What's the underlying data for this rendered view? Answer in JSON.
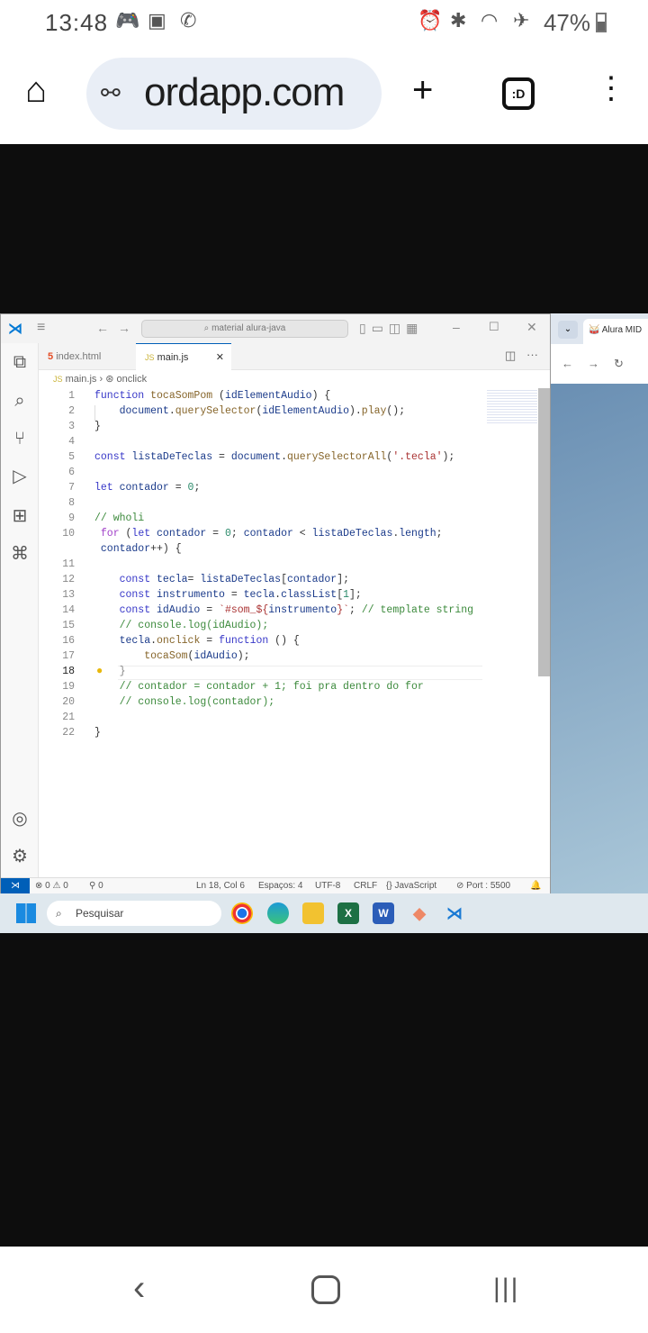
{
  "phone_status": {
    "time": "13:48",
    "battery": "47%",
    "left_icons": [
      "discord-icon",
      "voicemail-icon",
      "whatsapp-icon"
    ],
    "right_icons": [
      "alarm-icon",
      "bluetooth-icon",
      "wifi-icon",
      "airplane-icon"
    ]
  },
  "browser_toolbar": {
    "url": "ordapp.com",
    "tabs_label": ":D"
  },
  "vscode": {
    "search": "material alura-java",
    "tabs": [
      {
        "label": "index.html",
        "icon": "5"
      },
      {
        "label": "main.js",
        "icon": "JS"
      }
    ],
    "breadcrumb": {
      "file": "main.js",
      "symbol": "onclick",
      "icon": "JS"
    },
    "current_line": 18,
    "lines": [
      {
        "n": "1",
        "tokens": [
          [
            "kw",
            "function "
          ],
          [
            "fn",
            "tocaSomPom"
          ],
          [
            "pn",
            " ("
          ],
          [
            "vr",
            "idElementAudio"
          ],
          [
            "pn",
            ") {"
          ]
        ]
      },
      {
        "n": "2",
        "tokens": [
          [
            "vr",
            "    document"
          ],
          [
            "pn",
            "."
          ],
          [
            "fn",
            "querySelector"
          ],
          [
            "pn",
            "("
          ],
          [
            "vr",
            "idElementAudio"
          ],
          [
            "pn",
            ")."
          ],
          [
            "fn",
            "play"
          ],
          [
            "pn",
            "();"
          ]
        ]
      },
      {
        "n": "3",
        "tokens": [
          [
            "pn",
            "}"
          ]
        ]
      },
      {
        "n": "4",
        "tokens": []
      },
      {
        "n": "5",
        "tokens": [
          [
            "kw",
            "const "
          ],
          [
            "vr",
            "listaDeTeclas"
          ],
          [
            "pn",
            " = "
          ],
          [
            "vr",
            "document"
          ],
          [
            "pn",
            "."
          ],
          [
            "fn",
            "querySelectorAll"
          ],
          [
            "pn",
            "("
          ],
          [
            "str",
            "'.tecla'"
          ],
          [
            "pn",
            ");"
          ]
        ]
      },
      {
        "n": "6",
        "tokens": []
      },
      {
        "n": "7",
        "tokens": [
          [
            "kw",
            "let "
          ],
          [
            "vr",
            "contador"
          ],
          [
            "pn",
            " = "
          ],
          [
            "num",
            "0"
          ],
          [
            "pn",
            ";"
          ]
        ]
      },
      {
        "n": "8",
        "tokens": []
      },
      {
        "n": "9",
        "tokens": [
          [
            "cm",
            "// wholi"
          ]
        ]
      },
      {
        "n": "10",
        "tokens": [
          [
            "ctl",
            " for"
          ],
          [
            "pn",
            " ("
          ],
          [
            "kw",
            "let "
          ],
          [
            "vr",
            "contador"
          ],
          [
            "pn",
            " = "
          ],
          [
            "num",
            "0"
          ],
          [
            "pn",
            "; "
          ],
          [
            "vr",
            "contador"
          ],
          [
            "pn",
            " < "
          ],
          [
            "vr",
            "listaDeTeclas"
          ],
          [
            "pn",
            "."
          ],
          [
            "vr",
            "length"
          ],
          [
            "pn",
            ";"
          ]
        ]
      },
      {
        "n": "",
        "tokens": [
          [
            "vr",
            " contador"
          ],
          [
            "pn",
            "++) {"
          ]
        ]
      },
      {
        "n": "11",
        "tokens": []
      },
      {
        "n": "12",
        "tokens": [
          [
            "kw",
            "    const "
          ],
          [
            "vr",
            "tecla"
          ],
          [
            "pn",
            "= "
          ],
          [
            "vr",
            "listaDeTeclas"
          ],
          [
            "pn",
            "["
          ],
          [
            "vr",
            "contador"
          ],
          [
            "pn",
            "];"
          ]
        ]
      },
      {
        "n": "13",
        "tokens": [
          [
            "kw",
            "    const "
          ],
          [
            "vr",
            "instrumento"
          ],
          [
            "pn",
            " = "
          ],
          [
            "vr",
            "tecla"
          ],
          [
            "pn",
            "."
          ],
          [
            "vr",
            "classList"
          ],
          [
            "pn",
            "["
          ],
          [
            "num",
            "1"
          ],
          [
            "pn",
            "];"
          ]
        ]
      },
      {
        "n": "14",
        "tokens": [
          [
            "kw",
            "    const "
          ],
          [
            "vr",
            "idAudio"
          ],
          [
            "pn",
            " = "
          ],
          [
            "str",
            "`#som_${"
          ],
          [
            "vr",
            "instrumento"
          ],
          [
            "str",
            "}`"
          ],
          [
            "pn",
            "; "
          ],
          [
            "cm",
            "// template string"
          ]
        ]
      },
      {
        "n": "15",
        "tokens": [
          [
            "cm",
            "    // console.log(idAudio);"
          ]
        ]
      },
      {
        "n": "16",
        "tokens": [
          [
            "vr",
            "    tecla"
          ],
          [
            "pn",
            "."
          ],
          [
            "fn",
            "onclick"
          ],
          [
            "pn",
            " = "
          ],
          [
            "kw",
            "function"
          ],
          [
            "pn",
            " () {"
          ]
        ]
      },
      {
        "n": "17",
        "tokens": [
          [
            "fn",
            "        tocaSom"
          ],
          [
            "pn",
            "("
          ],
          [
            "vr",
            "idAudio"
          ],
          [
            "pn",
            ");"
          ]
        ]
      },
      {
        "n": "18",
        "tokens": [
          [
            "br",
            "    }"
          ]
        ]
      },
      {
        "n": "19",
        "tokens": [
          [
            "cm",
            "    // contador = contador + 1; foi pra dentro do for"
          ]
        ]
      },
      {
        "n": "20",
        "tokens": [
          [
            "cm",
            "    // console.log(contador);"
          ]
        ]
      },
      {
        "n": "21",
        "tokens": []
      },
      {
        "n": "22",
        "tokens": [
          [
            "pn",
            "}"
          ]
        ]
      }
    ],
    "statusbar": {
      "errors": "0",
      "warnings": "0",
      "ports": "0",
      "position": "Ln 18, Col 6",
      "spaces": "Espaços: 4",
      "encoding": "UTF-8",
      "eol": "CRLF",
      "language": "JavaScript",
      "port": "Port : 5500"
    }
  },
  "browser_panel": {
    "tab_title": "Alura MID"
  },
  "taskbar": {
    "search_placeholder": "Pesquisar",
    "apps": [
      "chrome",
      "edge",
      "file-explorer",
      "excel",
      "word",
      "git",
      "vscode"
    ]
  }
}
